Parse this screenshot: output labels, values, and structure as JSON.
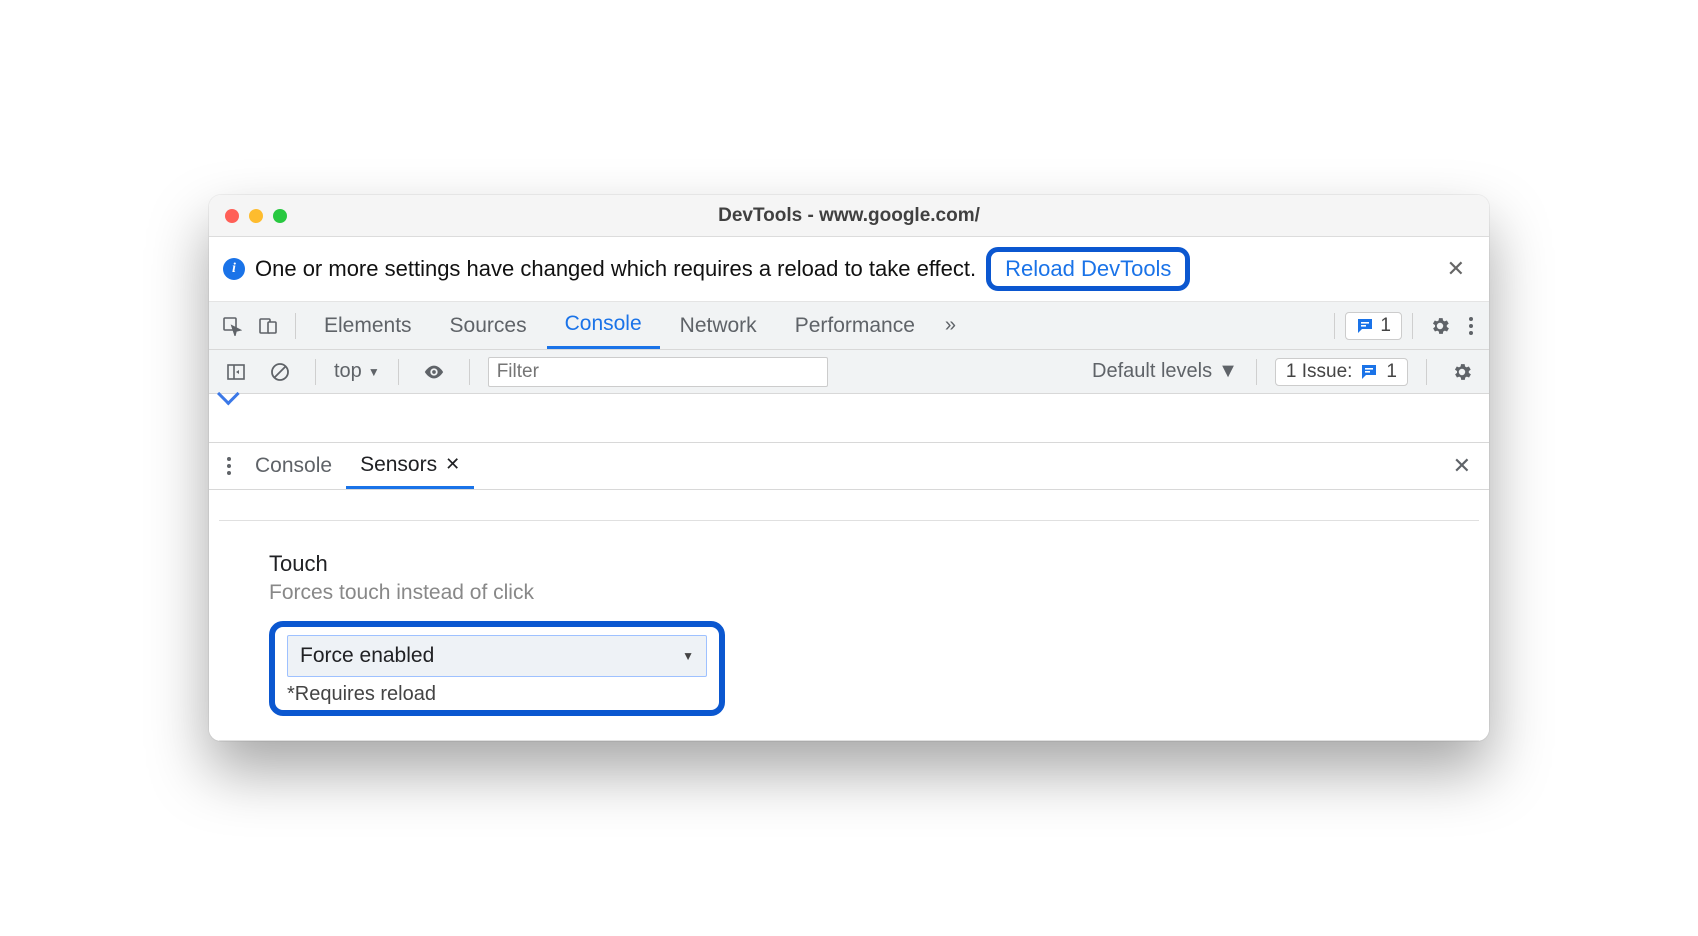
{
  "window": {
    "title": "DevTools - www.google.com/"
  },
  "infobar": {
    "message": "One or more settings have changed which requires a reload to take effect.",
    "button": "Reload DevTools"
  },
  "main_tabs": [
    "Elements",
    "Sources",
    "Console",
    "Network",
    "Performance"
  ],
  "main_tabs_active": "Console",
  "issues_badge_count": "1",
  "console_toolbar": {
    "context": "top",
    "filter_placeholder": "Filter",
    "levels": "Default levels",
    "issues_label": "1 Issue:",
    "issues_count": "1"
  },
  "drawer_tabs": {
    "items": [
      "Console",
      "Sensors"
    ],
    "active": "Sensors"
  },
  "sensor_setting": {
    "title": "Touch",
    "description": "Forces touch instead of click",
    "value": "Force enabled",
    "note": "*Requires reload"
  }
}
